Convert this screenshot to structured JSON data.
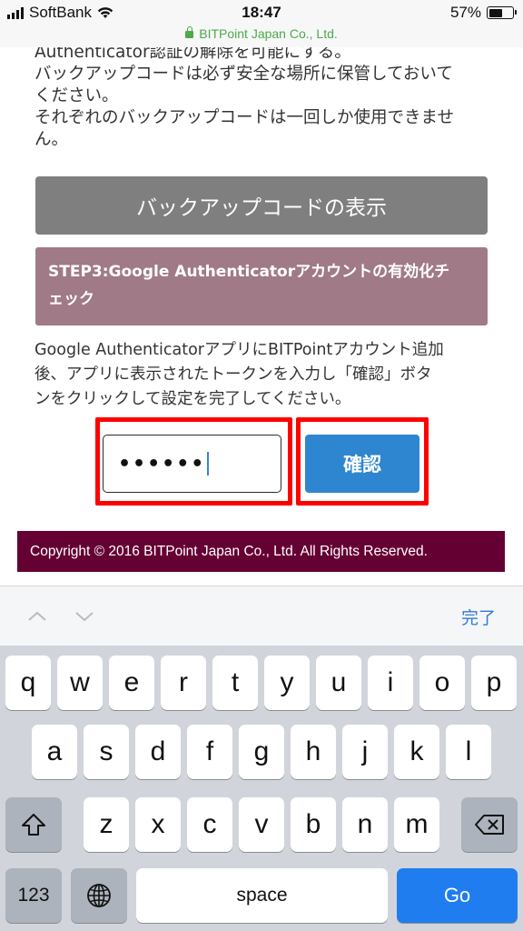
{
  "status_bar": {
    "carrier": "SoftBank",
    "time": "18:47",
    "battery_percent_text": "57%",
    "battery_level": 0.57
  },
  "url_bar": {
    "site": "BITPoint Japan Co., Ltd.",
    "secure_color": "#4caa4a"
  },
  "content": {
    "intro_lines": [
      "Authenticator認証の解除を可能にする。",
      "バックアップコードは必ず安全な場所に保管しておいて",
      "ください。",
      "それぞれのバックアップコードは一回しか使用できませ",
      "ん。"
    ],
    "backup_button_label": "バックアップコードの表示",
    "step3_title_line1": "STEP3:Google Authenticatorアカウントの有効化チ",
    "step3_title_line2": "ェック",
    "instruction_lines": [
      "Google AuthenticatorアプリにBITPointアカウント追加",
      "後、アプリに表示されたトークンを入力し「確認」ボタ",
      "ンをクリックして設定を完了してください。"
    ],
    "token_input_value": "••••••",
    "confirm_button_label": "確認",
    "footer_text": "Copyright © 2016 BITPoint Japan Co., Ltd. All Rights Reserved.",
    "colors": {
      "backup_button": "#7f7f7f",
      "step_box": "#a07a87",
      "confirm_button": "#2d86cf",
      "highlight": "#ff0000",
      "footer": "#650033"
    }
  },
  "accessory_bar": {
    "prev_icon": "chevron-up-icon",
    "next_icon": "chevron-down-icon",
    "done_label": "完了"
  },
  "keyboard": {
    "row1": [
      "q",
      "w",
      "e",
      "r",
      "t",
      "y",
      "u",
      "i",
      "o",
      "p"
    ],
    "row2": [
      "a",
      "s",
      "d",
      "f",
      "g",
      "h",
      "j",
      "k",
      "l"
    ],
    "row3": [
      "z",
      "x",
      "c",
      "v",
      "b",
      "n",
      "m"
    ],
    "shift_icon": "shift-icon",
    "delete_icon": "backspace-icon",
    "numbers_label": "123",
    "globe_icon": "globe-icon",
    "space_label": "space",
    "go_label": "Go"
  }
}
